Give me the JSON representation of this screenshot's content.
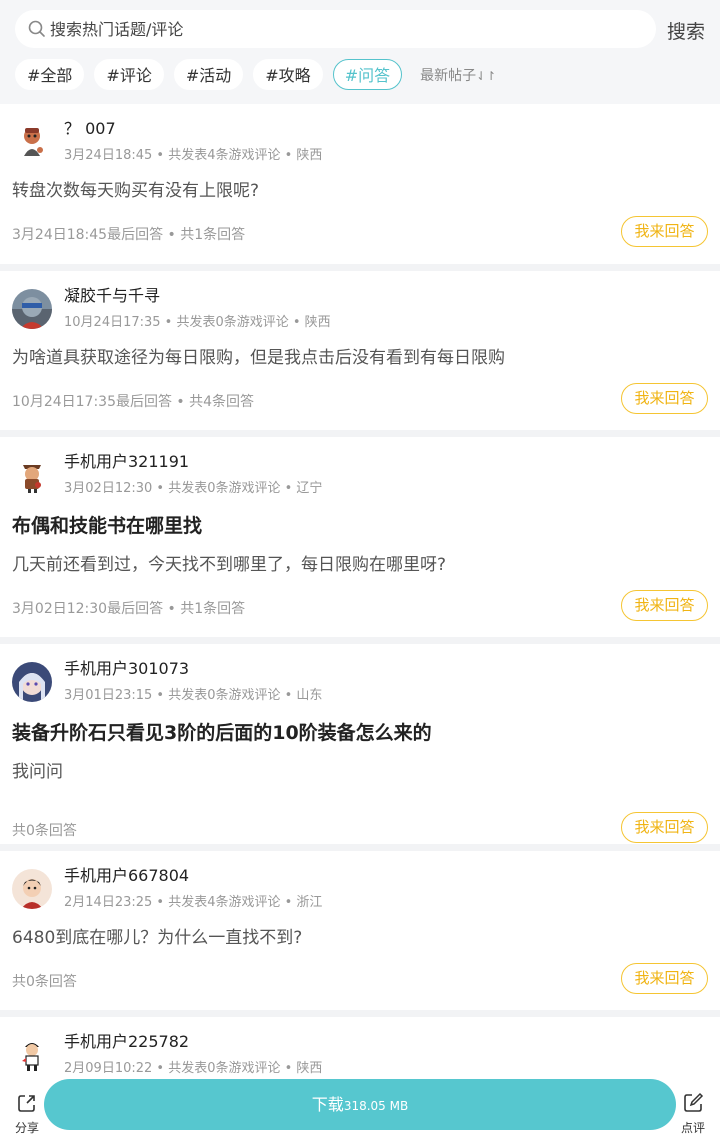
{
  "search": {
    "placeholder": "搜索热门话题/评论",
    "button": "搜索"
  },
  "tags": [
    {
      "label": "#全部",
      "active": false
    },
    {
      "label": "#评论",
      "active": false
    },
    {
      "label": "#活动",
      "active": false
    },
    {
      "label": "#攻略",
      "active": false
    },
    {
      "label": "#问答",
      "active": true
    }
  ],
  "sort": {
    "label": "最新帖子",
    "icon": "sort-arrows-icon"
  },
  "answer_label": "我来回答",
  "posts": [
    {
      "user": "？ 007",
      "meta": "3月24日18:45 • 共发表4条游戏评论 • 陕西",
      "title": "",
      "body": "转盘次数每天购买有没有上限呢?",
      "foot": "3月24日18:45最后回答 • 共1条回答",
      "avatar": "cartoon-character"
    },
    {
      "user": "凝胶千与千寻",
      "meta": "10月24日17:35 • 共发表0条游戏评论 • 陕西",
      "title": "",
      "body": "为啥道具获取途径为每日限购，但是我点击后没有看到有每日限购",
      "foot": "10月24日17:35最后回答 • 共4条回答",
      "avatar": "photo"
    },
    {
      "user": "手机用户321191",
      "meta": "3月02日12:30 • 共发表0条游戏评论 • 辽宁",
      "title": "布偶和技能书在哪里找",
      "body": "几天前还看到过，今天找不到哪里了，每日限购在哪里呀?",
      "foot": "3月02日12:30最后回答 • 共1条回答",
      "avatar": "cartoon-warrior"
    },
    {
      "user": "手机用户301073",
      "meta": "3月01日23:15 • 共发表0条游戏评论 • 山东",
      "title": "装备升阶石只看见3阶的后面的10阶装备怎么来的",
      "body": "我问问",
      "foot": "共0条回答",
      "avatar": "anime-girl"
    },
    {
      "user": "手机用户667804",
      "meta": "2月14日23:25 • 共发表4条游戏评论 • 浙江",
      "title": "",
      "body": "6480到底在哪儿？为什么一直找不到?",
      "foot": "共0条回答",
      "avatar": "cartoon-boy"
    },
    {
      "user": "手机用户225782",
      "meta": "2月09日10:22 • 共发表0条游戏评论 • 陕西",
      "title": "",
      "body": "",
      "foot": "",
      "avatar": "cartoon-runner"
    }
  ],
  "bottom": {
    "share": "分享",
    "download": "下载",
    "size": "318.05 MB",
    "review": "点评"
  },
  "colors": {
    "accent": "#55c3cc",
    "answer": "#f0b414",
    "download_bg": "#56c7cf"
  }
}
